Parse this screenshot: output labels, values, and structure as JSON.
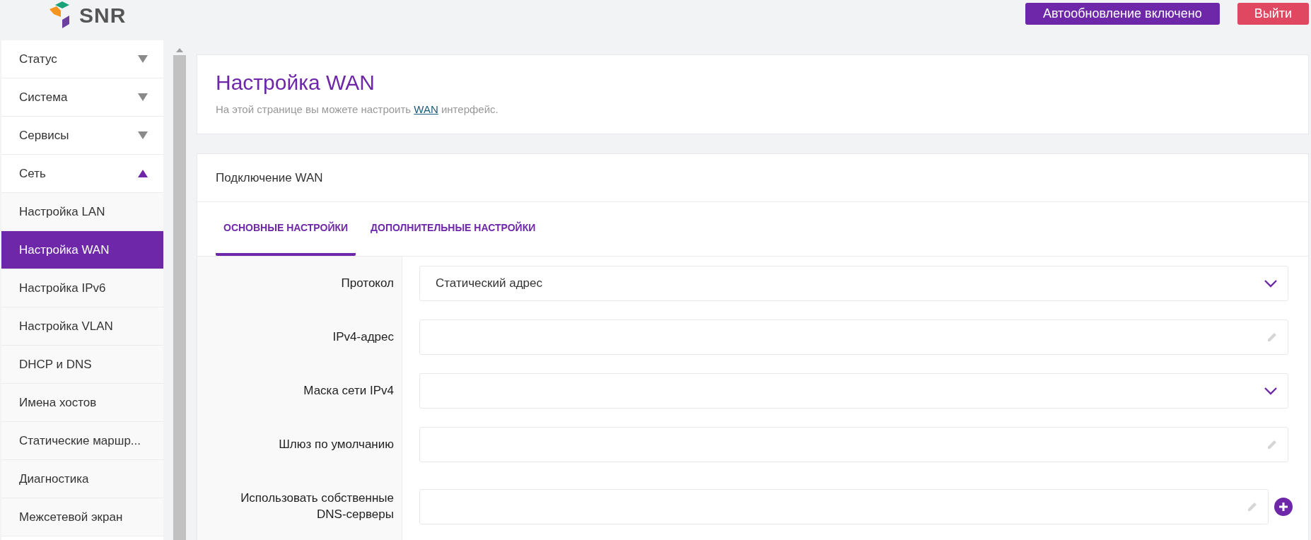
{
  "header": {
    "logo": "SNR",
    "buttons": [
      {
        "label": "Автообновление включено",
        "kind": "primary"
      },
      {
        "label": "Выйти",
        "kind": "danger"
      }
    ]
  },
  "sidebar": {
    "items": [
      {
        "kind": "group",
        "label": "Статус",
        "expanded": false
      },
      {
        "kind": "group",
        "label": "Система",
        "expanded": false
      },
      {
        "kind": "group",
        "label": "Сервисы",
        "expanded": false
      },
      {
        "kind": "group",
        "label": "Сеть",
        "expanded": true
      },
      {
        "kind": "item",
        "label": "Настройка LAN",
        "selected": false
      },
      {
        "kind": "item",
        "label": "Настройка WAN",
        "selected": true
      },
      {
        "kind": "item",
        "label": "Настройка IPv6",
        "selected": false
      },
      {
        "kind": "item",
        "label": "Настройка VLAN",
        "selected": false
      },
      {
        "kind": "item",
        "label": "DHCP и DNS",
        "selected": false
      },
      {
        "kind": "item",
        "label": "Имена хостов",
        "selected": false
      },
      {
        "kind": "item",
        "label": "Статические маршр...",
        "selected": false
      },
      {
        "kind": "item",
        "label": "Диагностика",
        "selected": false
      },
      {
        "kind": "item",
        "label": "Межсетевой экран",
        "selected": false
      }
    ]
  },
  "page": {
    "title": "Настройка WAN",
    "description": [
      "На этой странице вы можете настроить ",
      "WAN",
      " интерфейс."
    ]
  },
  "section": {
    "title": "Подключение WAN",
    "tabs": [
      {
        "label": "ОСНОВНЫЕ НАСТРОЙКИ",
        "selected": true
      },
      {
        "label": "ДОПОЛНИТЕЛЬНЫЕ НАСТРОЙКИ",
        "selected": false
      }
    ],
    "fields": [
      {
        "label": "Протокол",
        "kind": "select",
        "value": "Статический адрес"
      },
      {
        "label": "IPv4-адрес",
        "kind": "text"
      },
      {
        "label": "Маска сети IPv4",
        "kind": "select"
      },
      {
        "label": "Шлюз по умолчанию",
        "kind": "text"
      },
      {
        "label": "Использовать собственные DNS-серверы",
        "kind": "list"
      }
    ]
  }
}
